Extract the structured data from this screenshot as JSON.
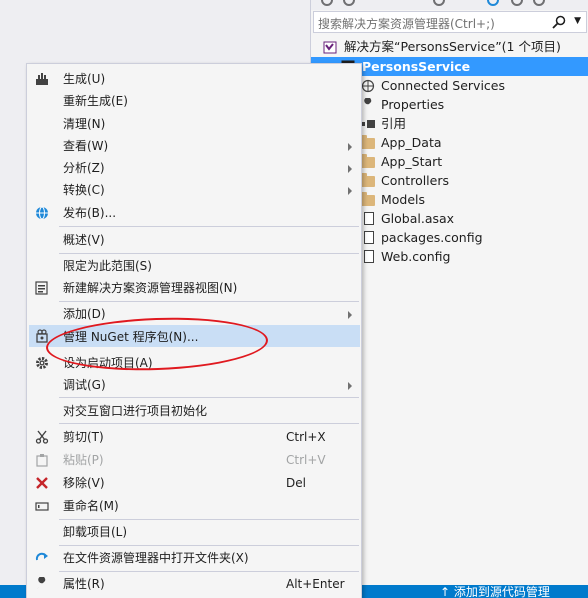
{
  "solution_explorer": {
    "search_placeholder": "搜索解决方案资源管理器(Ctrl+;)",
    "tree": [
      {
        "label": "解决方案“PersonsService”(1 个项目)",
        "icon": "solution-icon"
      },
      {
        "label": "PersonsService",
        "icon": "project-icon",
        "selected": true
      },
      {
        "label": "Connected Services",
        "icon": "connected-services-icon"
      },
      {
        "label": "Properties",
        "icon": "wrench-icon"
      },
      {
        "label": "引用",
        "icon": "references-icon"
      },
      {
        "label": "App_Data",
        "icon": "folder-icon"
      },
      {
        "label": "App_Start",
        "icon": "folder-icon"
      },
      {
        "label": "Controllers",
        "icon": "folder-icon"
      },
      {
        "label": "Models",
        "icon": "folder-icon"
      },
      {
        "label": "Global.asax",
        "icon": "file-icon"
      },
      {
        "label": "packages.config",
        "icon": "file-icon"
      },
      {
        "label": "Web.config",
        "icon": "file-icon"
      }
    ]
  },
  "context_menu": {
    "items": [
      {
        "label": "生成(U)",
        "icon": "build-icon"
      },
      {
        "label": "重新生成(E)"
      },
      {
        "label": "清理(N)"
      },
      {
        "label": "查看(W)",
        "submenu": true
      },
      {
        "label": "分析(Z)",
        "submenu": true
      },
      {
        "label": "转换(C)",
        "submenu": true
      },
      {
        "label": "发布(B)...",
        "icon": "globe-icon"
      },
      {
        "label": "概述(V)"
      },
      {
        "label": "限定为此范围(S)"
      },
      {
        "label": "新建解决方案资源管理器视图(N)",
        "icon": "new-view-icon"
      },
      {
        "label": "添加(D)",
        "submenu": true
      },
      {
        "label": "管理 NuGet 程序包(N)...",
        "icon": "nuget-icon",
        "highlighted": true
      },
      {
        "label": "设为启动项目(A)",
        "icon": "gear-icon"
      },
      {
        "label": "调试(G)",
        "submenu": true
      },
      {
        "label": "对交互窗口进行项目初始化"
      },
      {
        "label": "剪切(T)",
        "shortcut": "Ctrl+X",
        "icon": "scissors-icon"
      },
      {
        "label": "粘贴(P)",
        "shortcut": "Ctrl+V",
        "icon": "paste-icon",
        "disabled": true
      },
      {
        "label": "移除(V)",
        "shortcut": "Del",
        "icon": "delete-x-icon"
      },
      {
        "label": "重命名(M)",
        "icon": "rename-icon"
      },
      {
        "label": "卸载项目(L)"
      },
      {
        "label": "在文件资源管理器中打开文件夹(X)",
        "icon": "open-folder-icon"
      },
      {
        "label": "属性(R)",
        "shortcut": "Alt+Enter",
        "icon": "wrench-icon"
      }
    ]
  },
  "status_bar": {
    "text": "添加到源代码管理"
  },
  "colors": {
    "selection": "#3399ff",
    "menu_highlight": "#c9def5",
    "status_bar": "#007acc",
    "annotation": "#e0191f"
  }
}
